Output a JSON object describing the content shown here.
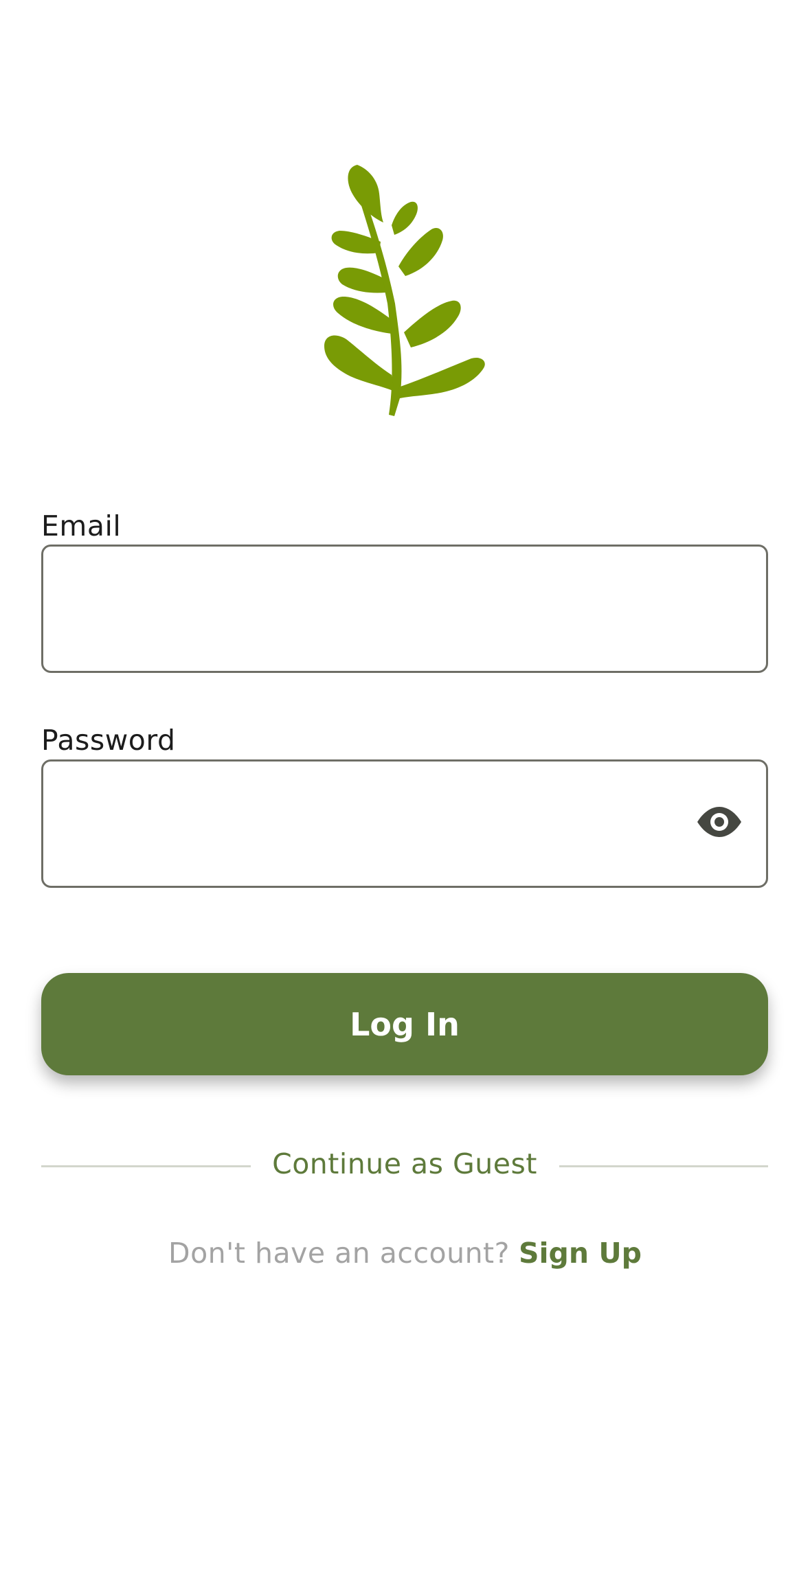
{
  "logo": {
    "icon": "leaf-branch-icon",
    "color": "#799b05"
  },
  "email": {
    "label": "Email",
    "value": "",
    "placeholder": ""
  },
  "password": {
    "label": "Password",
    "value": "",
    "placeholder": "",
    "toggle_icon": "eye-icon"
  },
  "login": {
    "label": "Log In",
    "color": "#5e7a3b"
  },
  "guest": {
    "label": "Continue as Guest"
  },
  "signup": {
    "prompt": "Don't have an account?",
    "link": "Sign Up"
  }
}
